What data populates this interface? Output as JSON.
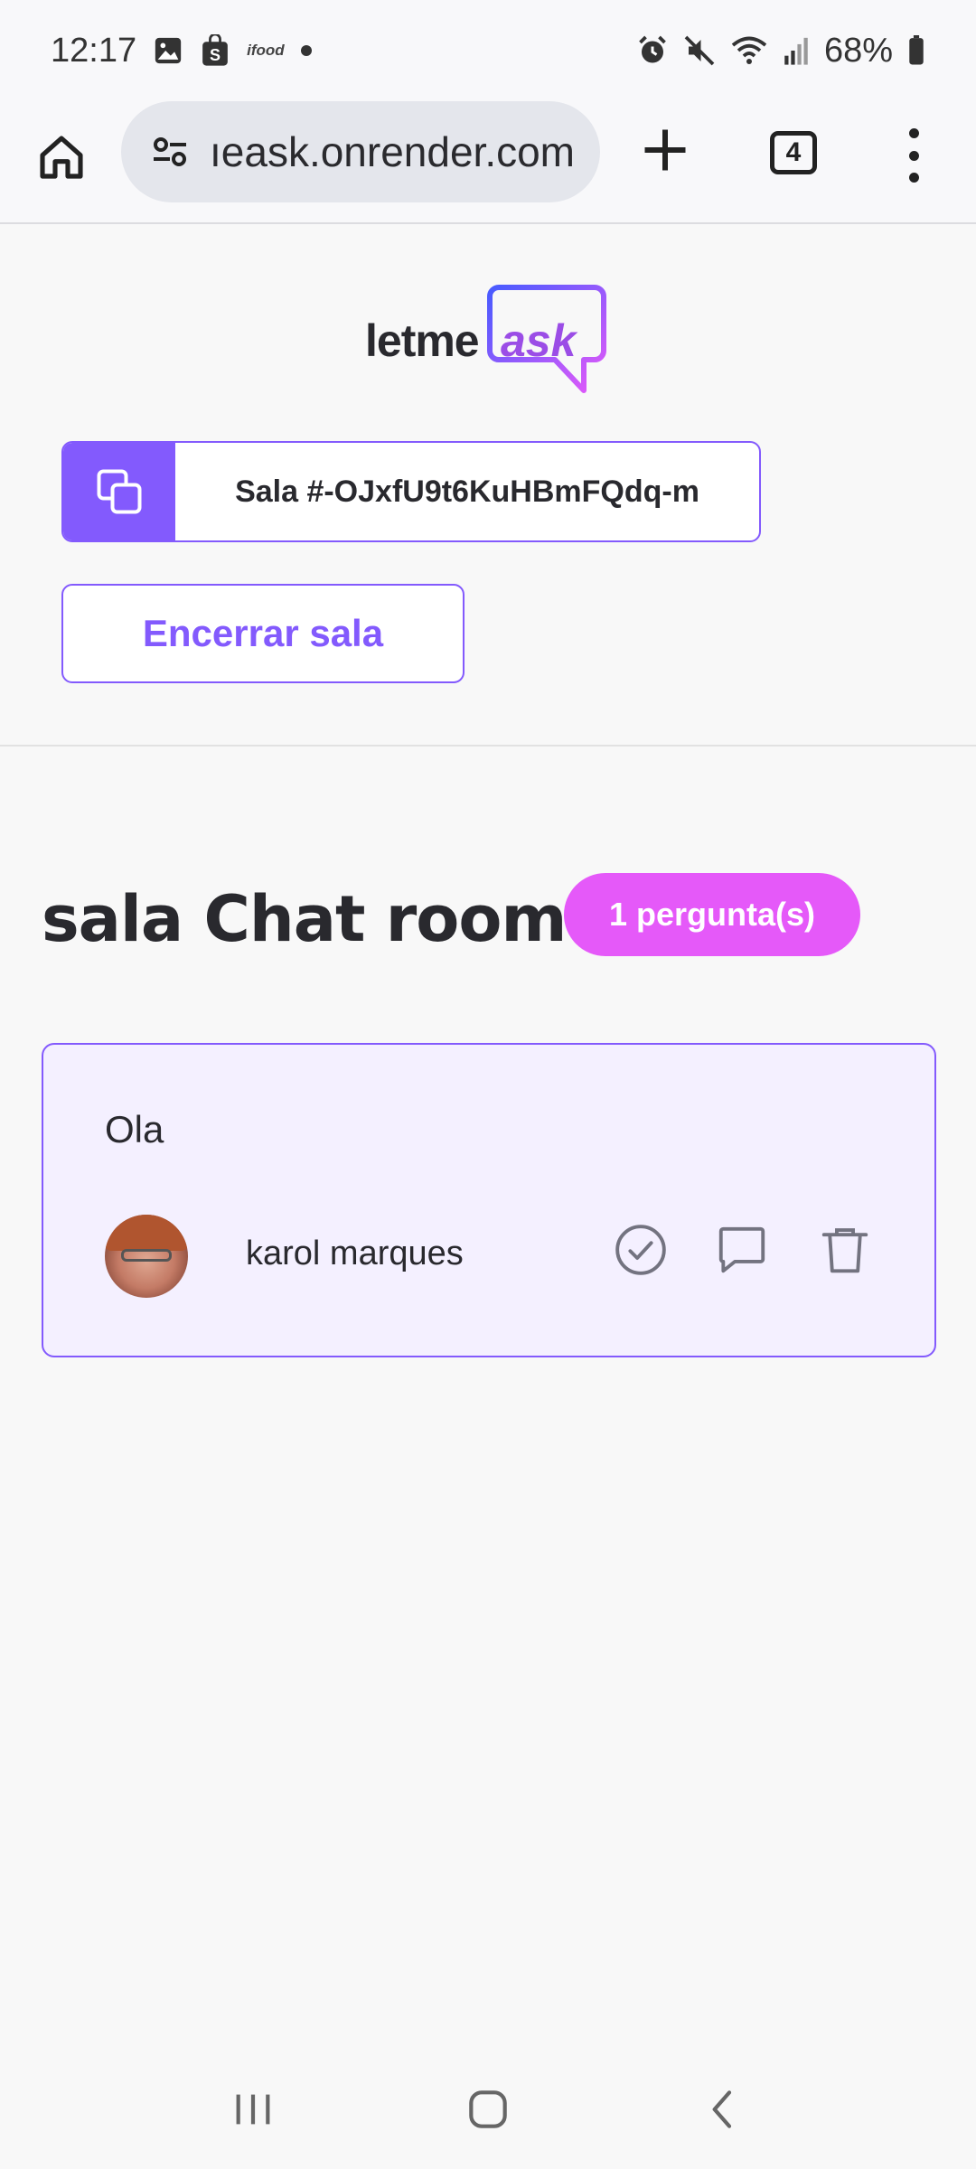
{
  "status_bar": {
    "time": "12:17",
    "notification_icons": [
      "gallery-icon",
      "shopping-bag-icon",
      "ifood-icon",
      "dot-icon"
    ],
    "ifood_label": "ifood",
    "system_icons": [
      "alarm-icon",
      "mute-icon",
      "wifi-icon",
      "signal-icon"
    ],
    "battery": "68%"
  },
  "browser": {
    "url": "ıeask.onrender.com",
    "tab_count": "4"
  },
  "header": {
    "logo_text_left": "letme",
    "logo_text_right": "ask",
    "room_code": "Sala #-OJxfU9t6KuHBmFQdq-m",
    "close_room_label": "Encerrar sala"
  },
  "room": {
    "title": "sala Chat room",
    "question_count": "1 pergunta(s)"
  },
  "questions": [
    {
      "content": "Ola",
      "author": "karol marques"
    }
  ],
  "colors": {
    "primary": "#835afd",
    "pink": "#e559f9",
    "question_bg": "#f4f0ff",
    "text": "#29292e"
  }
}
